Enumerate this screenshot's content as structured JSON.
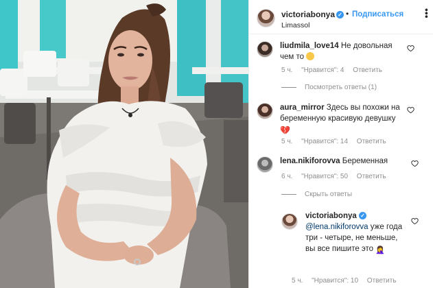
{
  "post": {
    "author": "victoriabonya",
    "follow_label": "Подписаться",
    "dot": "•",
    "location": "Limassol",
    "verified_mark": "✓"
  },
  "comments": [
    {
      "user": "liudmila_love14",
      "text": "Не довольная чем то",
      "emoji": "😩",
      "time": "5 ч.",
      "likes": "\"Нравится\": 4",
      "reply": "Ответить",
      "view_replies": "Посмотреть ответы (1)"
    },
    {
      "user": "aura_mirror",
      "text": "Здесь вы похожи на беременную красивую девушку",
      "emoji": "💔",
      "time": "5 ч.",
      "likes": "\"Нравится\": 14",
      "reply": "Ответить"
    },
    {
      "user": "lena.nikiforovva",
      "text": "Беременная",
      "time": "6 ч.",
      "likes": "\"Нравится\": 50",
      "reply": "Ответить",
      "hide_replies": "Скрыть ответы"
    }
  ],
  "reply": {
    "user": "victoriabonya",
    "mention": "@lena.nikiforovva",
    "text": "уже года три - четыре, не меньше, вы все пишите это",
    "emoji": "🤦‍♀️",
    "time": "5 ч.",
    "likes": "\"Нравится\": 10",
    "reply": "Ответить"
  },
  "colors": {
    "accent": "#3897f0",
    "meta": "#8e8e8e",
    "heart_broken": "#d6303f",
    "pool": "#3fc6c8"
  },
  "icons": [
    "more-options-icon",
    "verified-badge-icon",
    "heart-icon",
    "weary-face-emoji",
    "broken-heart-emoji",
    "facepalm-emoji"
  ]
}
